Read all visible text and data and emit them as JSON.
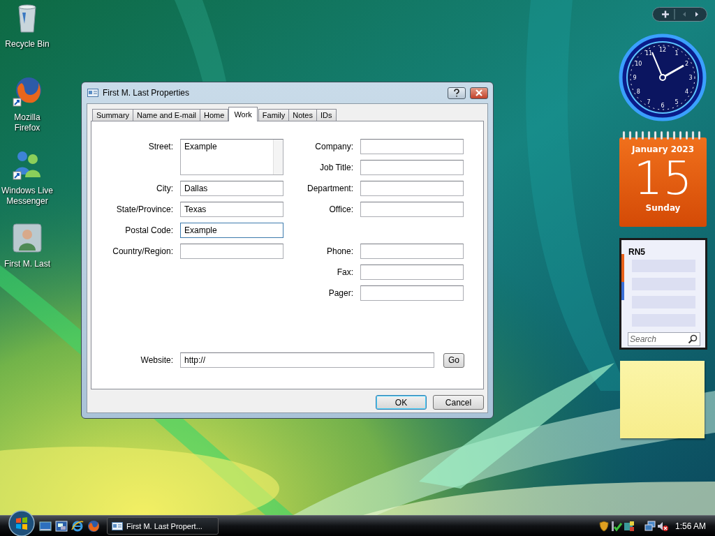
{
  "desktop_icons": [
    {
      "label": "Recycle Bin",
      "kind": "recycle"
    },
    {
      "label": "Mozilla Firefox",
      "kind": "firefox"
    },
    {
      "label": "Windows Live Messenger",
      "kind": "messenger"
    },
    {
      "label": "First M. Last",
      "kind": "contact"
    }
  ],
  "dialog": {
    "title": "First M. Last Properties",
    "tabs": [
      {
        "label": "Summary",
        "selected": false
      },
      {
        "label": "Name and E-mail",
        "selected": false
      },
      {
        "label": "Home",
        "selected": false
      },
      {
        "label": "Work",
        "selected": true
      },
      {
        "label": "Family",
        "selected": false
      },
      {
        "label": "Notes",
        "selected": false
      },
      {
        "label": "IDs",
        "selected": false
      }
    ],
    "address_fields": [
      {
        "label": "Street:",
        "value": "Example",
        "kind": "multiline",
        "focused": false
      },
      {
        "label": "City:",
        "value": "Dallas",
        "kind": "text",
        "focused": false
      },
      {
        "label": "State/Province:",
        "value": "Texas",
        "kind": "text",
        "focused": false
      },
      {
        "label": "Postal Code:",
        "value": "Example",
        "kind": "text",
        "focused": true
      },
      {
        "label": "Country/Region:",
        "kind": "text",
        "focused": false
      }
    ],
    "organization_fields": [
      {
        "label": "Company:",
        "kind": "text",
        "focused": false
      },
      {
        "label": "Job Title:",
        "kind": "text",
        "focused": false
      },
      {
        "label": "Department:",
        "kind": "text",
        "focused": false
      },
      {
        "label": "Office:",
        "kind": "text",
        "focused": false
      }
    ],
    "contact_fields": [
      {
        "label": "Phone:",
        "kind": "text",
        "focused": false
      },
      {
        "label": "Fax:",
        "kind": "text",
        "focused": false
      },
      {
        "label": "Pager:",
        "kind": "text",
        "focused": false
      }
    ],
    "website": {
      "label": "Website:",
      "value": "http://",
      "button": "Go"
    },
    "buttons": [
      {
        "label": "OK",
        "default": true
      },
      {
        "label": "Cancel",
        "default": false
      }
    ]
  },
  "sidebar": {
    "clock": {
      "numerals": [
        "12",
        "1",
        "2",
        "3",
        "4",
        "5",
        "6",
        "7",
        "8",
        "9",
        "10",
        "11"
      ]
    },
    "calendar": {
      "month": "January 2023",
      "day": "15",
      "weekday": "Sunday"
    },
    "notes_gadget": {
      "title": "RN5",
      "search": {
        "placeholder": "Search"
      }
    }
  },
  "taskbar": {
    "tasks": [
      {
        "label": "First M. Last Propert..."
      }
    ],
    "clock": "1:56 AM"
  }
}
